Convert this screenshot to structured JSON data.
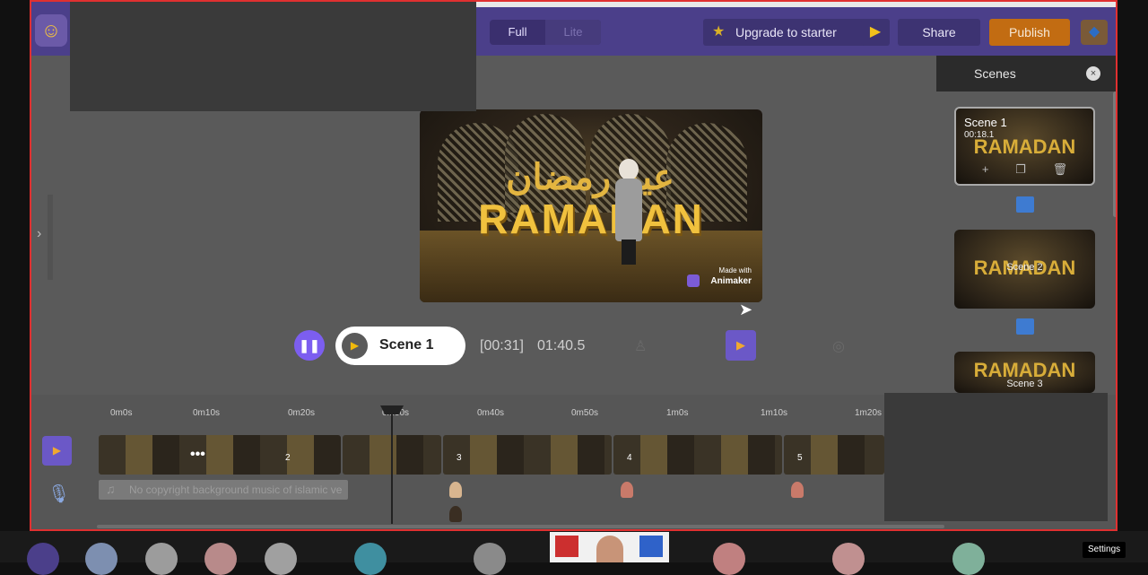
{
  "topbar": {
    "view_full": "Full",
    "view_lite": "Lite",
    "upgrade_label": "Upgrade to starter",
    "share_label": "Share",
    "publish_label": "Publish"
  },
  "canvas": {
    "title": "RAMADAN",
    "arabic": "عيد رمضان",
    "watermark_small": "Made with",
    "watermark_brand": "Animaker"
  },
  "playback": {
    "scene_label": "Scene 1",
    "current_time": "[00:31]",
    "total_time": "01:40.5"
  },
  "scenes_panel": {
    "title": "Scenes",
    "scenes": [
      {
        "name": "Scene 1",
        "duration": "00:18.1",
        "thumb_text": "RAMADAN"
      },
      {
        "name": "Scene 2",
        "thumb_text": "RAMADAN"
      },
      {
        "name": "Scene 3",
        "thumb_text": "RAMADAN"
      }
    ]
  },
  "timeline": {
    "ruler": [
      "0m0s",
      "0m10s",
      "0m20s",
      "0m30s",
      "0m40s",
      "0m50s",
      "1m0s",
      "1m10s",
      "1m20s"
    ],
    "clip_numbers": [
      "2",
      "3",
      "4",
      "5"
    ],
    "music_label": "No copyright background music of islamic ve"
  },
  "taskbar": {
    "settings_label": "Settings"
  },
  "colors": {
    "brand_purple": "#4b3f8a",
    "publish_orange": "#c26c12",
    "accent_gold": "#f0c13e",
    "frame_red": "#e03030"
  }
}
